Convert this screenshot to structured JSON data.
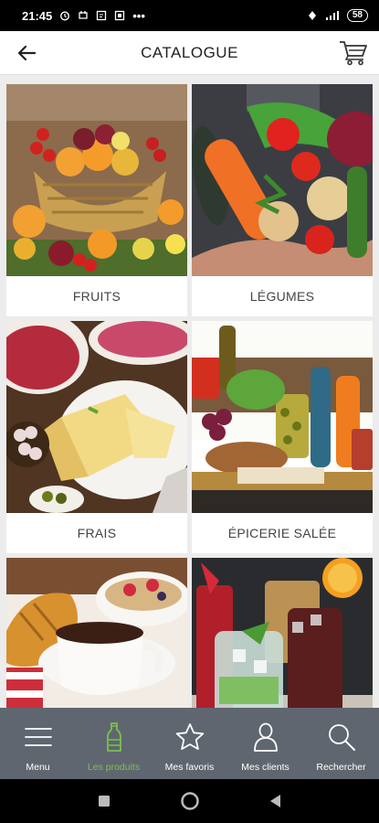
{
  "status_bar": {
    "time": "21:45",
    "dots": "•••",
    "battery": "58"
  },
  "header": {
    "title": "CATALOGUE"
  },
  "categories": [
    {
      "label": "FRUITS"
    },
    {
      "label": "LÉGUMES"
    },
    {
      "label": "FRAIS"
    },
    {
      "label": "ÉPICERIE SALÉE"
    },
    {
      "label": ""
    },
    {
      "label": ""
    }
  ],
  "bottom_nav": {
    "items": [
      {
        "label": "Menu",
        "icon": "menu-icon"
      },
      {
        "label": "Les produits",
        "icon": "bottle-icon",
        "active": true
      },
      {
        "label": "Mes favoris",
        "icon": "star-icon"
      },
      {
        "label": "Mes clients",
        "icon": "user-icon"
      },
      {
        "label": "Rechercher",
        "icon": "search-icon"
      }
    ]
  },
  "colors": {
    "nav_bg": "#5f6670",
    "active": "#7bc24a",
    "background": "#ececec"
  }
}
